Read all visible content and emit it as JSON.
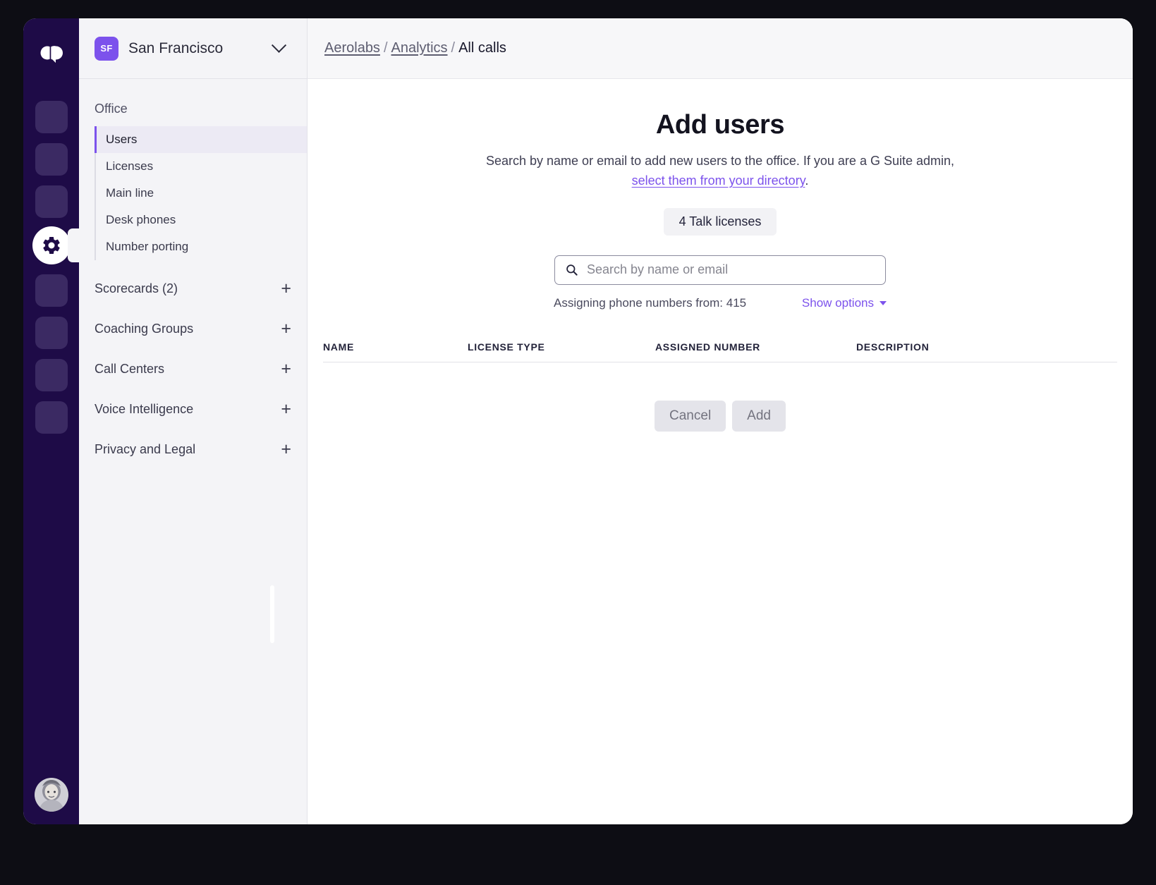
{
  "window": {
    "brand_logo_icon": "dialpad-logo-icon"
  },
  "icon_rail": {
    "gear_icon": "gear-icon",
    "avatar_icon": "user-avatar",
    "placeholder_count_top": 3,
    "placeholder_count_bottom": 4
  },
  "sidebar": {
    "office": {
      "badge": "SF",
      "name": "San Francisco",
      "chevron_icon": "chevron-down-icon"
    },
    "group_title": "Office",
    "sub_items": [
      {
        "label": "Users",
        "active": true
      },
      {
        "label": "Licenses",
        "active": false
      },
      {
        "label": "Main line",
        "active": false
      },
      {
        "label": "Desk phones",
        "active": false
      },
      {
        "label": "Number porting",
        "active": false
      }
    ],
    "sections": [
      {
        "label": "Scorecards (2)",
        "expand": "+"
      },
      {
        "label": "Coaching Groups",
        "expand": "+"
      },
      {
        "label": "Call Centers",
        "expand": "+"
      },
      {
        "label": "Voice Intelligence",
        "expand": "+"
      },
      {
        "label": "Privacy and Legal",
        "expand": "+"
      }
    ]
  },
  "breadcrumb": {
    "item1": "Aerolabs",
    "sep1": "/",
    "item2": "Analytics",
    "sep2": "/",
    "current": "All calls"
  },
  "main": {
    "title": "Add users",
    "description_before": "Search by name or email to add new users to the office. If you are a G Suite admin,",
    "description_link": "select them from your directory",
    "description_after": ".",
    "license_badge": "4 Talk licenses",
    "search": {
      "placeholder": "Search by name or email",
      "value": "",
      "icon": "search-icon"
    },
    "assigning_text": "Assigning phone numbers from: 415",
    "show_options_label": "Show options",
    "show_options_caret": "caret-down-icon",
    "table": {
      "columns": [
        "NAME",
        "LICENSE TYPE",
        "ASSIGNED NUMBER",
        "DESCRIPTION"
      ],
      "rows": []
    },
    "cancel_label": "Cancel",
    "add_label": "Add"
  },
  "colors": {
    "accent": "#7c52ec",
    "rail_bg": "#1e0b47",
    "sidebar_bg": "#f4f4f7",
    "badge_bg": "#f2f2f5",
    "disabled_btn": "#e4e4ea"
  }
}
